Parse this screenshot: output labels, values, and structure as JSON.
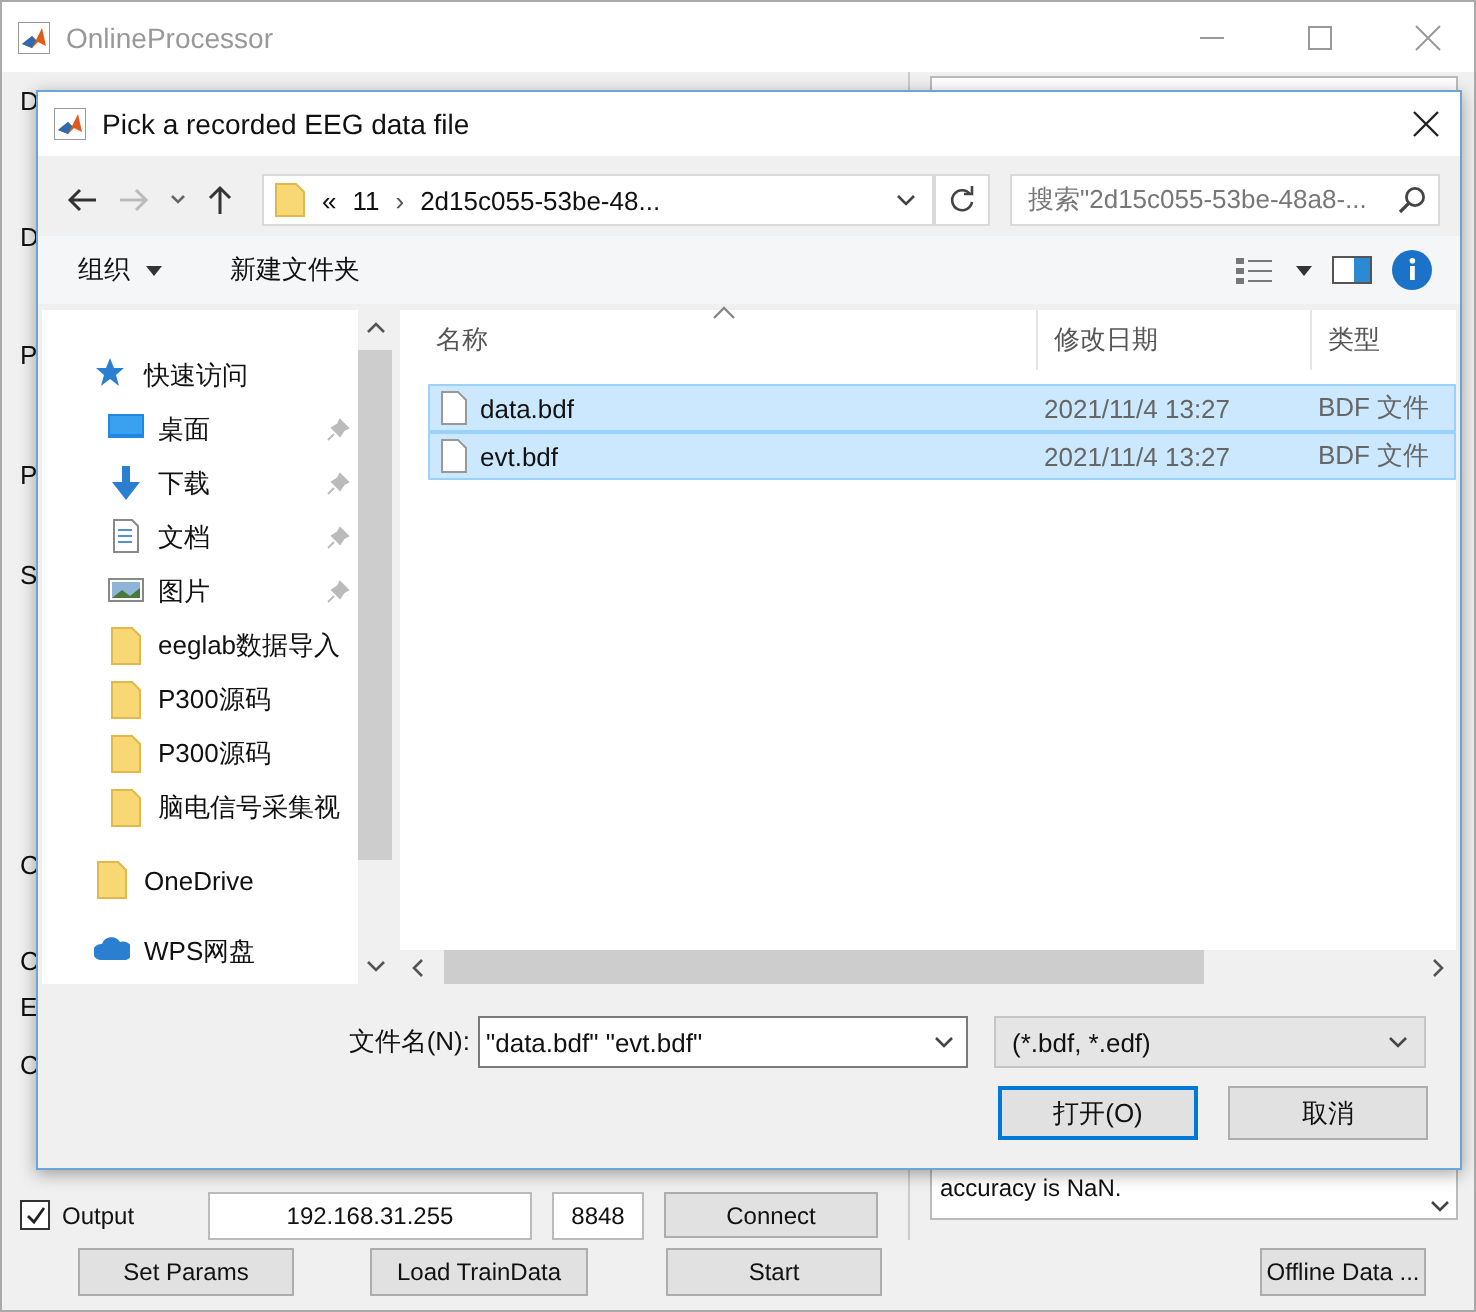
{
  "window": {
    "title": "OnlineProcessor"
  },
  "panel_labels": [
    "D",
    "D",
    "P",
    "P",
    "S",
    "C",
    "C",
    "E",
    "C"
  ],
  "connections": [
    {
      "label": "Output",
      "checked": true,
      "address": "192.168.31.255",
      "port": "8848",
      "button": "Connect"
    }
  ],
  "log": {
    "lines": [
      "accuracy is NaN."
    ]
  },
  "buttons": [
    "Set Params",
    "Load TrainData",
    "Start",
    "Offline Data ..."
  ],
  "dialog": {
    "title": "Pick a recorded EEG data file",
    "address": {
      "overflow": "«",
      "path": [
        "11",
        "2d15c055-53be-48..."
      ],
      "separator": "›"
    },
    "search": {
      "placeholder": "搜索\"2d15c055-53be-48a8-..."
    },
    "toolbar": {
      "organize": "组织",
      "new_folder": "新建文件夹"
    },
    "nav_items": [
      {
        "label": "快速访问",
        "kind": "star",
        "children": [
          {
            "label": "桌面",
            "kind": "desktop",
            "pinned": true
          },
          {
            "label": "下载",
            "kind": "download",
            "pinned": true
          },
          {
            "label": "文档",
            "kind": "document",
            "pinned": true
          },
          {
            "label": "图片",
            "kind": "image",
            "pinned": true
          },
          {
            "label": "eeglab数据导入",
            "kind": "folder",
            "pinned": false
          },
          {
            "label": "P300源码",
            "kind": "folder",
            "pinned": false
          },
          {
            "label": "P300源码",
            "kind": "folder",
            "pinned": false
          },
          {
            "label": "脑电信号采集视",
            "kind": "folder",
            "pinned": false
          }
        ]
      },
      {
        "label": "OneDrive",
        "kind": "folder"
      },
      {
        "label": "WPS网盘",
        "kind": "cloud"
      }
    ],
    "columns": [
      "名称",
      "修改日期",
      "类型"
    ],
    "files": [
      {
        "name": "data.bdf",
        "modified": "2021/11/4 13:27",
        "type": "BDF 文件",
        "selected": true
      },
      {
        "name": "evt.bdf",
        "modified": "2021/11/4 13:27",
        "type": "BDF 文件",
        "selected": true
      }
    ],
    "filename": {
      "label": "文件名(N):",
      "value": "\"data.bdf\" \"evt.bdf\""
    },
    "filter": "(*.bdf, *.edf)",
    "open_button": "打开(O)",
    "cancel_button": "取消"
  }
}
